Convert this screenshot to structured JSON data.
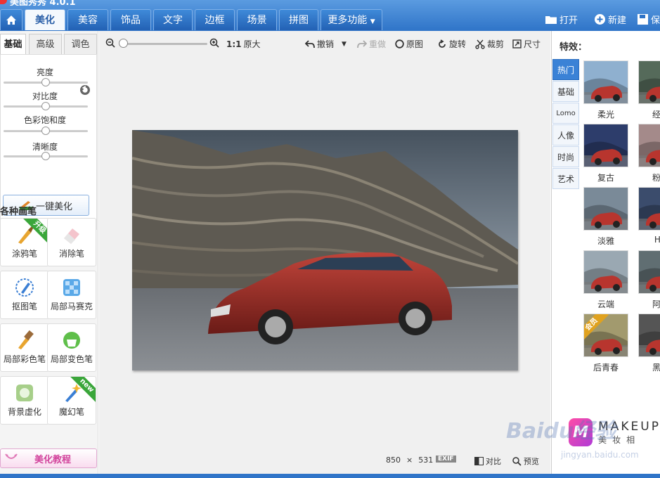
{
  "app": {
    "title": "美图秀秀 4.0.1"
  },
  "nav_tabs": [
    {
      "label": "美化",
      "active": true
    },
    {
      "label": "美容"
    },
    {
      "label": "饰品"
    },
    {
      "label": "文字"
    },
    {
      "label": "边框"
    },
    {
      "label": "场景"
    },
    {
      "label": "拼图"
    },
    {
      "label": "更多功能"
    }
  ],
  "top_actions": {
    "open": "打开",
    "new": "新建",
    "save": "保"
  },
  "adjust": {
    "tabs": [
      "基础",
      "高级",
      "调色"
    ],
    "sliders": [
      {
        "label": "亮度",
        "value": 0.5
      },
      {
        "label": "对比度",
        "value": 0.5
      },
      {
        "label": "色彩饱和度",
        "value": 0.5
      },
      {
        "label": "清晰度",
        "value": 0.5
      }
    ],
    "onekey_label": "一键美化"
  },
  "brushes": {
    "title": "各种画笔",
    "items": [
      {
        "label": "涂鸦笔",
        "badge": "升级"
      },
      {
        "label": "消除笔"
      },
      {
        "label": "抠图笔"
      },
      {
        "label": "局部马赛克"
      },
      {
        "label": "局部彩色笔"
      },
      {
        "label": "局部变色笔"
      },
      {
        "label": "背景虚化"
      },
      {
        "label": "魔幻笔",
        "badge": "new"
      }
    ]
  },
  "tutorial_label": "美化教程",
  "toolbar": {
    "zoom_ratio": "1:1",
    "original_size": "原大",
    "undo": "撤销",
    "redo": "重做",
    "original": "原图",
    "rotate": "旋转",
    "crop": "裁剪",
    "size": "尺寸"
  },
  "image_info": {
    "width": "850",
    "times": "×",
    "height": "531",
    "exif": "EXIF",
    "compare": "对比",
    "preview": "预览"
  },
  "effects": {
    "title": "特效：",
    "categories": [
      {
        "label": "热门",
        "active": true
      },
      {
        "label": "基础"
      },
      {
        "label": "Lomo"
      },
      {
        "label": "人像"
      },
      {
        "label": "时尚"
      },
      {
        "label": "艺术"
      }
    ],
    "thumbs": [
      {
        "label": "柔光",
        "tint": "#8fb0cf"
      },
      {
        "label": "经典",
        "tint": "#556a5a"
      },
      {
        "label": "复古",
        "tint": "#2d3d6b"
      },
      {
        "label": "粉红",
        "tint": "#a48a8a"
      },
      {
        "label": "淡雅",
        "tint": "#7a8a98"
      },
      {
        "label": "HD",
        "tint": "#3b4c6c"
      },
      {
        "label": "云端",
        "tint": "#9aa8b2"
      },
      {
        "label": "阿宝",
        "tint": "#606e72"
      },
      {
        "label": "后青春",
        "tint": "#a29a6e",
        "badge": "会员"
      },
      {
        "label": "黑白",
        "tint": "#555555"
      }
    ]
  },
  "makeup_ad": {
    "logo": "M",
    "line1": "MAKEUP",
    "line2": "美妆相"
  },
  "watermark": {
    "text": "Baidu经验",
    "url": "jingyan.baidu.com"
  }
}
